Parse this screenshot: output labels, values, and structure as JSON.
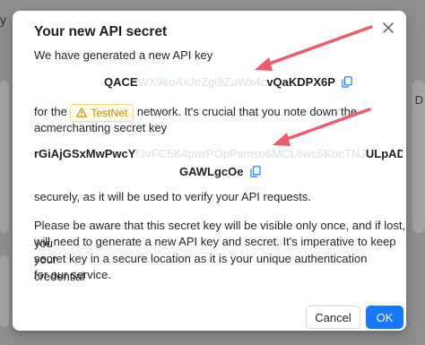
{
  "background": {
    "side_label": "y",
    "side_glyph": "D"
  },
  "modal": {
    "title": "Your new API secret",
    "intro": "We have generated a new API key",
    "api_key": {
      "prefix": "QACE",
      "masked": "WX9koAxJeZgi9ZuWx4c",
      "suffix": "vQaKDPX6P"
    },
    "network_prefix": "for the",
    "network_tag": "TestNet",
    "network_suffix": "network. It's crucial that you note down the",
    "secret_intro": "acmerchanting secret key",
    "secret": {
      "line1_prefix": "rGiAjGSxMwPwcY",
      "line1_masked": "f3vFC5K4pwrPOpPxmso6MCL6wc5KbeTNJ",
      "line1_suffix": "ULpADhBPW",
      "line2": "GAWLgcOe"
    },
    "secure_text": "securely, as it will be used to verify your API requests.",
    "warning_text": [
      "Please be aware that this secret key will be visible only once, and if lost, you",
      "will need to generate a new API key and secret. It's imperative to keep your",
      "secret key in a secure location as it is your unique authentication credential",
      "for our service."
    ],
    "cancel_label": "Cancel",
    "ok_label": "OK"
  },
  "colors": {
    "primary": "#1677ff",
    "warning": "#d48806",
    "arrow": "#f05a6a"
  },
  "icons": {
    "close": "close-icon",
    "copy": "copy-icon",
    "warning": "warning-icon"
  }
}
